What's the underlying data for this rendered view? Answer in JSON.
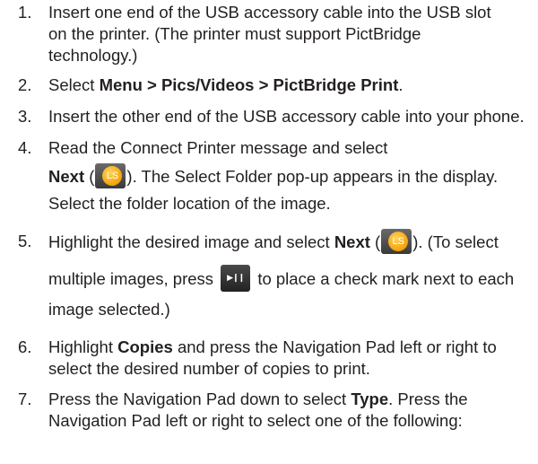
{
  "steps": [
    {
      "num": "1.",
      "lines": [
        "Insert one end of the USB accessory cable into the USB slot",
        "on the printer. (The printer must support PictBridge",
        "technology.)"
      ]
    },
    {
      "num": "2.",
      "pre": "Select ",
      "bold": "Menu > Pics/Videos > PictBridge Print",
      "post": "."
    },
    {
      "num": "3.",
      "text": "Insert the other end of the USB accessory cable into your phone."
    },
    {
      "num": "4.",
      "line1": "Read the Connect Printer message and select",
      "bold": "Next",
      "after_icon": "). The Select Folder pop-up appears in the display.",
      "line3": "Select the folder location of the image."
    },
    {
      "num": "5.",
      "pre": "Highlight the desired image and select ",
      "bold": "Next",
      "after_icon": "). (To select",
      "line2_pre": "multiple images, press ",
      "line2_post": " to place a check mark next to each",
      "line3": "image selected.)"
    },
    {
      "num": "6.",
      "pre": "Highlight ",
      "bold": "Copies",
      "post": " and press the Navigation Pad left or right to",
      "line2": "select the desired number of copies to print."
    },
    {
      "num": "7.",
      "pre": "Press the Navigation Pad down to select ",
      "bold": "Type",
      "post": ". Press the",
      "line2": "Navigation Pad left or right to select one of the following:"
    }
  ],
  "icons": {
    "left_soft_key": "LS",
    "play_pause_key": "▶❙❙"
  }
}
